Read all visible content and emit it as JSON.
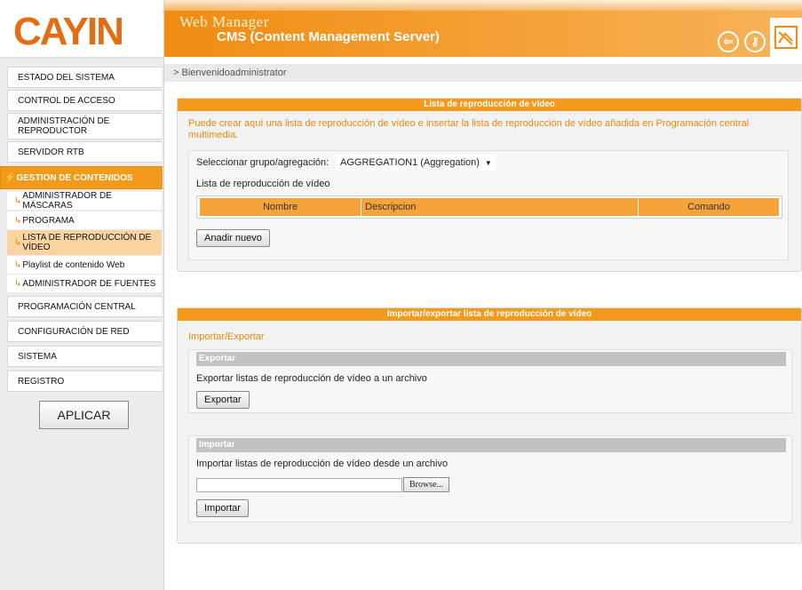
{
  "header": {
    "logo": "CAYIN",
    "title": "Web Manager",
    "subtitle": "CMS (Content Management Server)",
    "icons": [
      "exit-icon",
      "key-icon",
      "sitemap-icon"
    ]
  },
  "breadcrumb": "> Bienvenidoadministrator",
  "sidebar": {
    "items": [
      {
        "label": "ESTADO DEL SISTEMA"
      },
      {
        "label": "CONTROL DE ACCESO"
      },
      {
        "label": "ADMINISTRACIÓN DE REPRODUCTOR"
      },
      {
        "label": "SERVIDOR RTB"
      },
      {
        "label": "GESTION DE CONTENIDOS"
      },
      {
        "label": "ADMINISTRADOR DE MÁSCARAS"
      },
      {
        "label": "PROGRAMA"
      },
      {
        "label": "LISTA DE REPRODUCCIÓN DE VÍDEO"
      },
      {
        "label": "Playlist de contenido Web"
      },
      {
        "label": "ADMINISTRADOR DE FUENTES"
      },
      {
        "label": "PROGRAMACIÓN CENTRAL"
      },
      {
        "label": "CONFIGURACIÓN DE RED"
      },
      {
        "label": "SISTEMA"
      },
      {
        "label": "REGISTRO"
      }
    ],
    "apply_label": "APLICAR"
  },
  "playlist_panel": {
    "title": "Lista de reproducción de vídeo",
    "description": "Puede crear aquí una lista de reproducción de vídeo e insertar la lista de reproducción de vídeo añadida en Programación central multimedia.",
    "group_label": "Seleccionar grupo/agregación:",
    "group_value": "AGGREGATION1 (Aggregation)",
    "list_label": "Lista de reproducción de vídeo",
    "columns": [
      "Nombre",
      "Descripcion",
      "Comando"
    ],
    "add_label": "Anadir nuevo"
  },
  "import_export_panel": {
    "title": "Importar/exportar lista de reproducción de vídeo",
    "subtitle": "Importar/Exportar",
    "export": {
      "heading": "Exportar",
      "text": "Exportar listas de reproducción de vídeo a un archivo",
      "button": "Exportar"
    },
    "import": {
      "heading": "Importar",
      "text": "Importar listas de reproducción de vídeo desde un archivo",
      "browse": "Browse...",
      "button": "Importar"
    }
  },
  "colors": {
    "accent": "#f39a1c",
    "table_header": "#f6a33a",
    "section_bar": "#c2c2c2"
  }
}
